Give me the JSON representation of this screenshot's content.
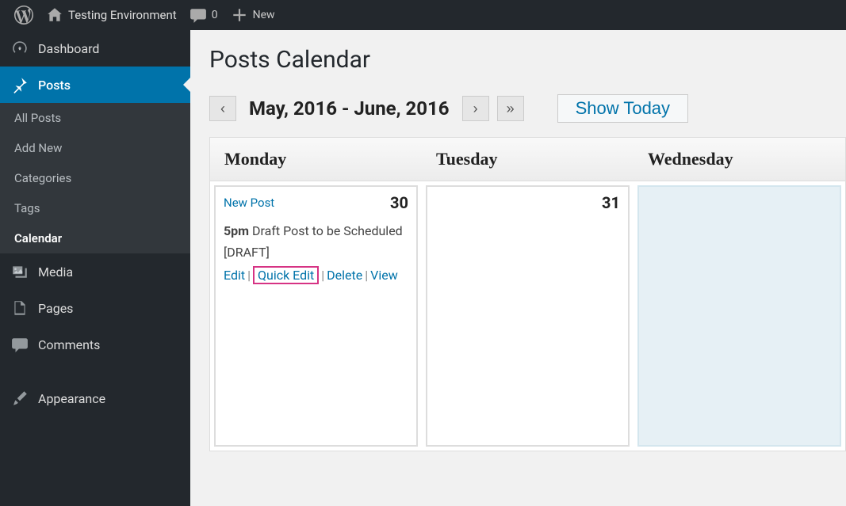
{
  "toolbar": {
    "site_name": "Testing Environment",
    "comments_count": "0",
    "new_label": "New"
  },
  "sidebar": {
    "dashboard": "Dashboard",
    "posts": "Posts",
    "posts_sub": {
      "all": "All Posts",
      "add": "Add New",
      "cats": "Categories",
      "tags": "Tags",
      "cal": "Calendar"
    },
    "media": "Media",
    "pages": "Pages",
    "comments": "Comments",
    "appearance": "Appearance"
  },
  "page": {
    "title": "Posts Calendar",
    "date_range": "May, 2016 - June, 2016",
    "prev_single": "‹",
    "next_single": "›",
    "next_double": "»",
    "show_today": "Show Today"
  },
  "calendar": {
    "headers": [
      "Monday",
      "Tuesday",
      "Wednesday"
    ],
    "days": [
      {
        "new_post": "New Post",
        "num": "30",
        "entry_time": "5pm",
        "entry_title": "Draft Post to be Scheduled [DRAFT]",
        "actions": {
          "edit": "Edit",
          "quick_edit": "Quick Edit",
          "delete": "Delete",
          "view": "View"
        }
      },
      {
        "num": "31"
      },
      {
        "fade": true
      }
    ]
  }
}
